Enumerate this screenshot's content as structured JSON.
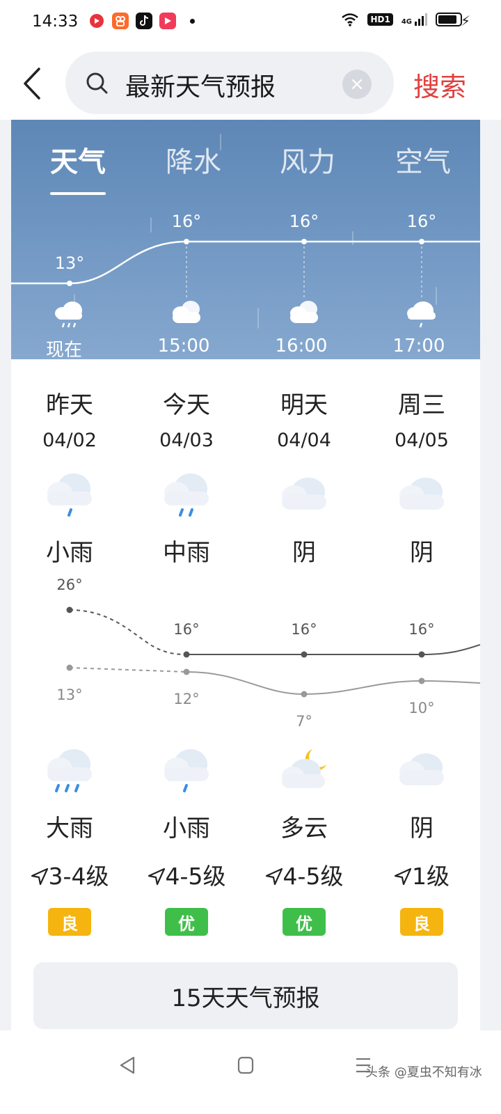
{
  "status_bar": {
    "time": "14:33",
    "network": "4G",
    "hd": "HD1",
    "app_icons": [
      "notification-icon",
      "kuaishou-icon",
      "douyin-icon",
      "video-icon"
    ]
  },
  "search": {
    "query": "最新天气预报",
    "button_label": "搜索",
    "clear_glyph": "×"
  },
  "hourly": {
    "tabs": [
      "天气",
      "降水",
      "风力",
      "空气"
    ],
    "active_tab": 0,
    "items": [
      {
        "time": "现在",
        "temp": "13°",
        "icon": "cloud-rain-icon"
      },
      {
        "time": "15:00",
        "temp": "16°",
        "icon": "cloudy-icon"
      },
      {
        "time": "16:00",
        "temp": "16°",
        "icon": "cloudy-icon"
      },
      {
        "time": "17:00",
        "temp": "16°",
        "icon": "cloud-drizzle-icon"
      }
    ]
  },
  "daily": {
    "days": [
      {
        "name": "昨天",
        "date": "04/02",
        "day_cond": "小雨",
        "high": "26°",
        "low": "13°",
        "night_cond": "大雨",
        "wind": "3-4级",
        "aqi": "良",
        "aqi_color": "#f5b40f"
      },
      {
        "name": "今天",
        "date": "04/03",
        "day_cond": "中雨",
        "high": "16°",
        "low": "12°",
        "night_cond": "小雨",
        "wind": "4-5级",
        "aqi": "优",
        "aqi_color": "#3fbf4a"
      },
      {
        "name": "明天",
        "date": "04/04",
        "day_cond": "阴",
        "high": "16°",
        "low": "7°",
        "night_cond": "多云",
        "wind": "4-5级",
        "aqi": "优",
        "aqi_color": "#3fbf4a"
      },
      {
        "name": "周三",
        "date": "04/05",
        "day_cond": "阴",
        "high": "16°",
        "low": "10°",
        "night_cond": "阴",
        "wind": "1级",
        "aqi": "良",
        "aqi_color": "#f5b40f"
      }
    ],
    "forecast_button": "15天天气预报"
  },
  "watermark": "头条 @夏虫不知有冰",
  "colors": {
    "accent_red": "#e0403f",
    "hourly_bg_top": "#5e87b6",
    "aqi_good": "#f5b40f",
    "aqi_excellent": "#3fbf4a"
  }
}
